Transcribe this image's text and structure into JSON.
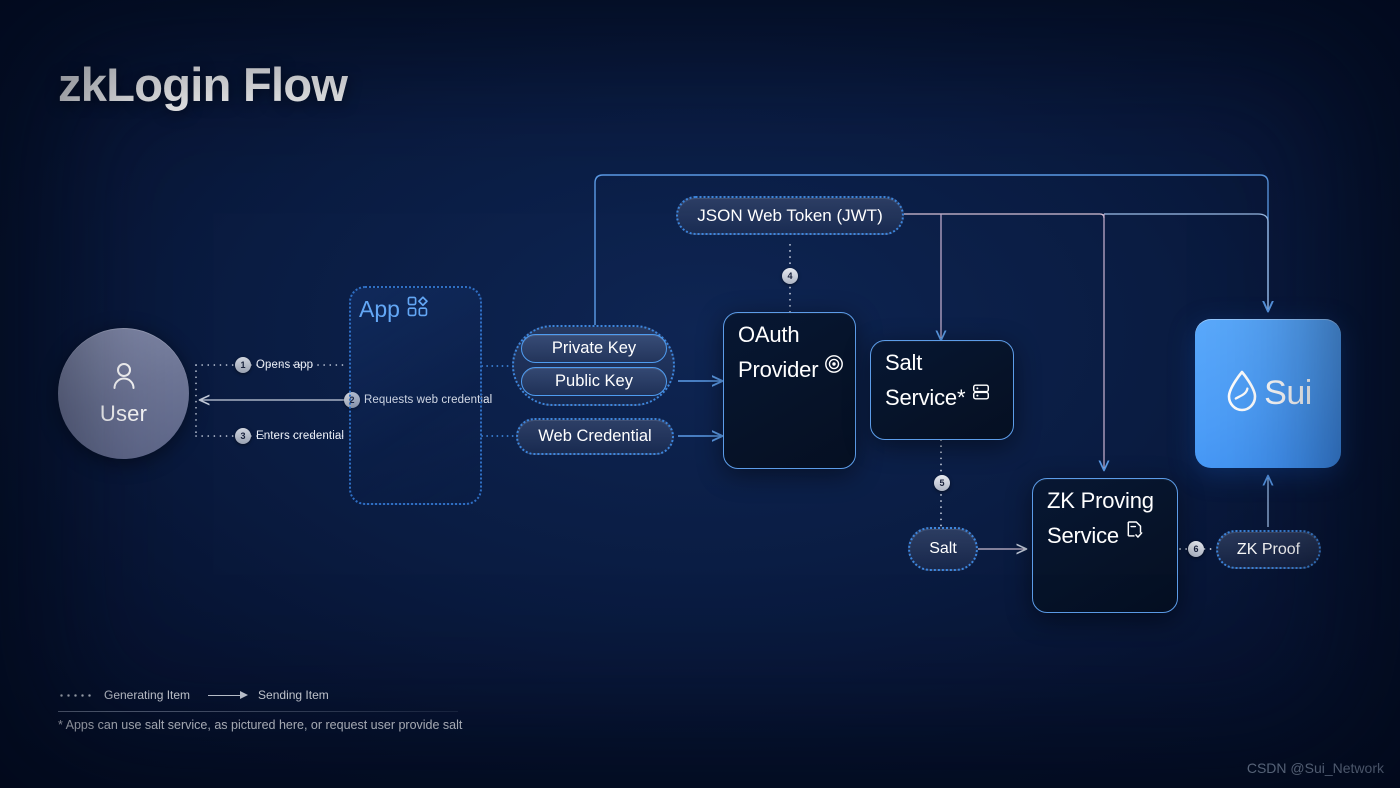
{
  "page": {
    "title": "zkLogin Flow",
    "watermark": "CSDN @Sui_Network",
    "bg_dark": "#050f26",
    "accent_blue": "#4d9ef8",
    "wire_blue": "#4f92e6",
    "wire_pink": "#d8c2d6"
  },
  "actors": {
    "user": {
      "label": "User",
      "icon": "user-icon"
    },
    "app": {
      "label": "App",
      "icon": "apps-grid-icon"
    },
    "oauth_provider": {
      "line1": "OAuth",
      "line2": "Provider",
      "icon": "fingerprint-icon"
    },
    "salt_service": {
      "line1": "Salt",
      "line2": "Service*",
      "icon": "server-icon"
    },
    "zk_proving_service": {
      "line1": "ZK Proving",
      "line2": "Service",
      "icon": "document-check-icon"
    },
    "sui": {
      "label": "Sui",
      "icon": "sui-droplet-icon"
    }
  },
  "artifacts": {
    "private_key": "Private Key",
    "public_key": "Public Key",
    "web_credential": "Web Credential",
    "jwt": "JSON Web Token (JWT)",
    "salt": "Salt",
    "zk_proof": "ZK Proof"
  },
  "steps": [
    {
      "num": "1",
      "label": "Opens app"
    },
    {
      "num": "2",
      "label": "Requests web credential"
    },
    {
      "num": "3",
      "label": "Enters credential"
    },
    {
      "num": "4",
      "label": ""
    },
    {
      "num": "5",
      "label": ""
    },
    {
      "num": "6",
      "label": ""
    }
  ],
  "legend": {
    "generating": "Generating Item",
    "sending": "Sending Item",
    "footnote": "* Apps can use salt service, as pictured here, or request user provide salt"
  }
}
